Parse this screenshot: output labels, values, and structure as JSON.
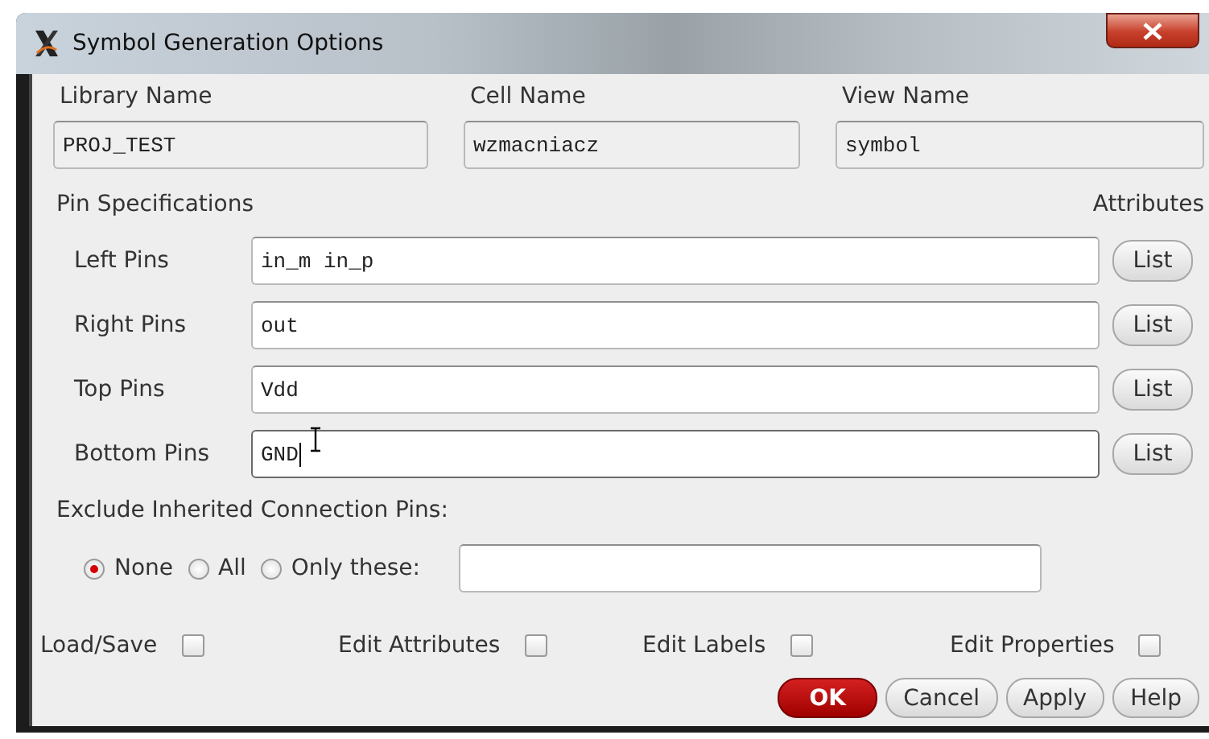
{
  "window": {
    "title": "Symbol Generation Options"
  },
  "names": [
    {
      "label": "Library Name",
      "value": "PROJ_TEST"
    },
    {
      "label": "Cell Name",
      "value": "wzmacniacz"
    },
    {
      "label": "View Name",
      "value": "symbol"
    }
  ],
  "pin_section": {
    "title": "Pin Specifications",
    "attributes_header": "Attributes"
  },
  "pins": [
    {
      "label": "Left Pins",
      "value": "in_m in_p",
      "button": "List",
      "focused": false
    },
    {
      "label": "Right Pins",
      "value": "out",
      "button": "List",
      "focused": false
    },
    {
      "label": "Top Pins",
      "value": "Vdd",
      "button": "List",
      "focused": false
    },
    {
      "label": "Bottom Pins",
      "value": "GND",
      "button": "List",
      "focused": true
    }
  ],
  "exclude": {
    "label": "Exclude Inherited Connection Pins:",
    "options": [
      {
        "label": "None",
        "selected": true
      },
      {
        "label": "All",
        "selected": false
      },
      {
        "label": "Only these:",
        "selected": false
      }
    ]
  },
  "toggles": [
    {
      "label": "Load/Save",
      "checked": false
    },
    {
      "label": "Edit Attributes",
      "checked": false
    },
    {
      "label": "Edit Labels",
      "checked": false
    },
    {
      "label": "Edit Properties",
      "checked": false
    }
  ],
  "buttons": [
    {
      "label": "OK",
      "kind": "primary"
    },
    {
      "label": "Cancel",
      "kind": "normal"
    },
    {
      "label": "Apply",
      "kind": "normal"
    },
    {
      "label": "Help",
      "kind": "normal"
    }
  ]
}
